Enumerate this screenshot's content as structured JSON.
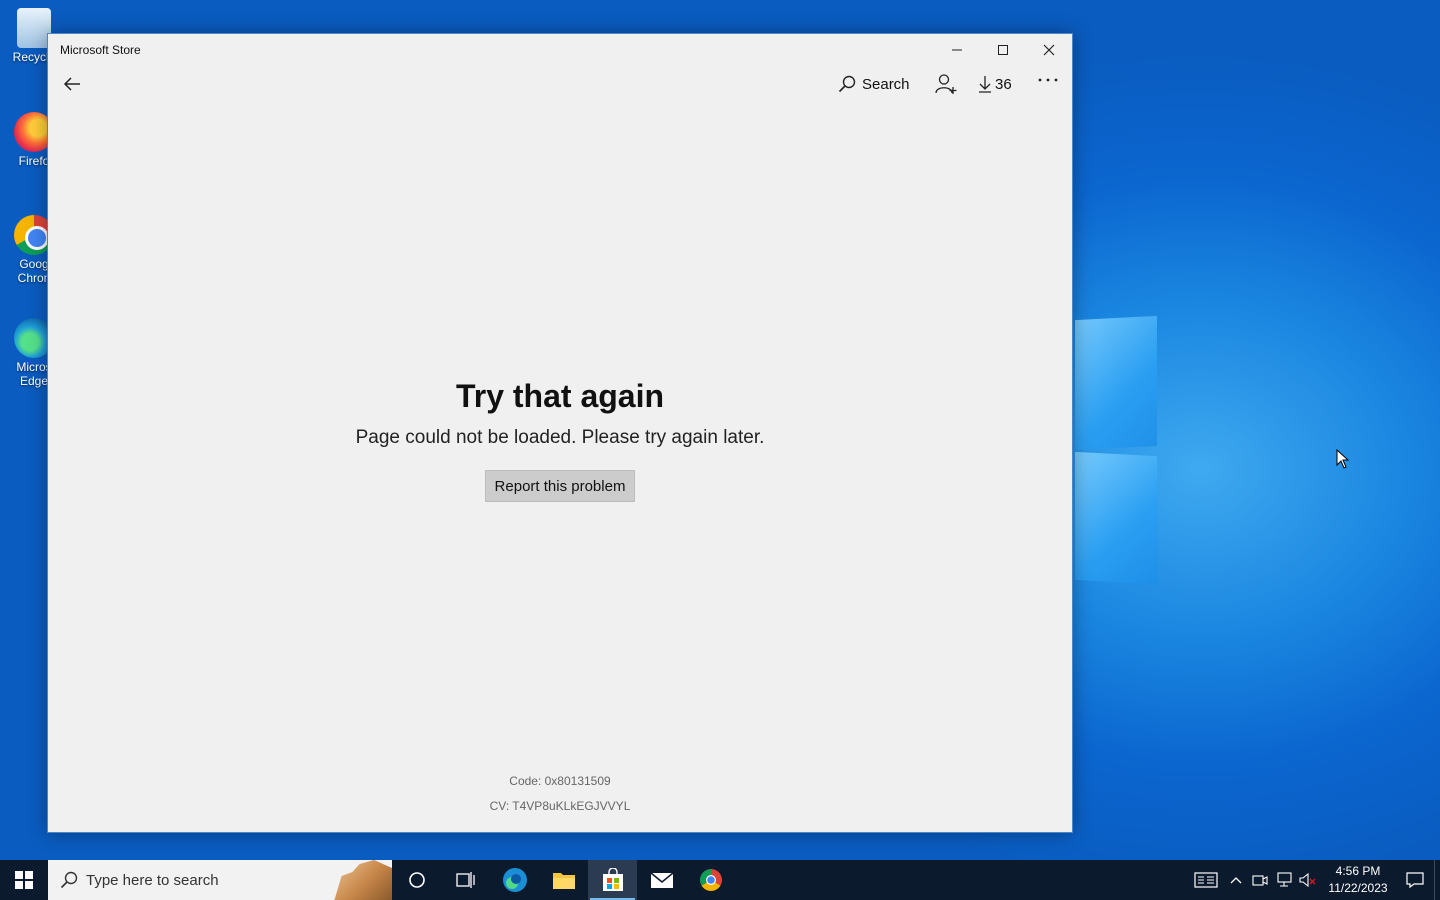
{
  "desktop": {
    "icons": [
      {
        "label": "Recycle"
      },
      {
        "label": "Firefo"
      },
      {
        "label": "Goog Chron"
      },
      {
        "label": "Micros Edge"
      }
    ]
  },
  "window": {
    "title": "Microsoft Store",
    "toolbar": {
      "search_label": "Search",
      "downloads_count": "36"
    },
    "error": {
      "title": "Try that again",
      "message": "Page could not be loaded. Please try again later.",
      "report_button": "Report this problem",
      "code": "Code: 0x80131509",
      "cv": "CV: T4VP8uKLkEGJVVYL"
    }
  },
  "taskbar": {
    "search_placeholder": "Type here to search",
    "clock_time": "4:56 PM",
    "clock_date": "11/22/2023"
  },
  "colors": {
    "desktop_blue": "#0a63c8",
    "window_bg": "#f0f0f0",
    "taskbar_bg": "#0c1a2e",
    "button_bg": "#cccccc"
  }
}
